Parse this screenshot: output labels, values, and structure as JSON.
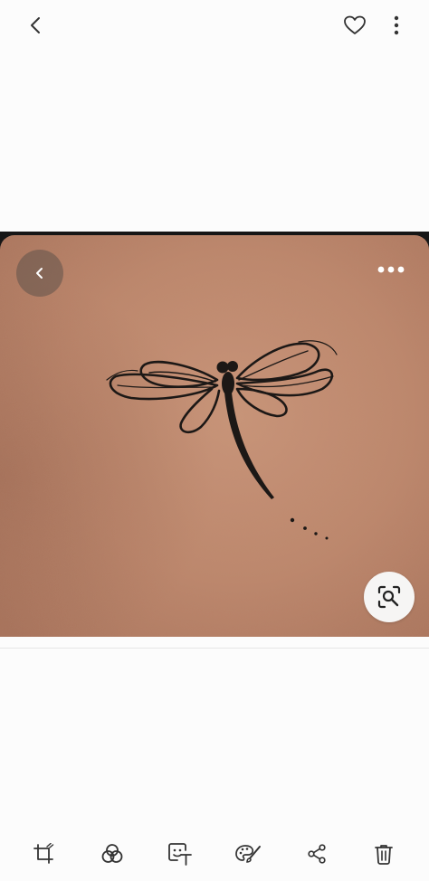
{
  "top_bar": {
    "icons": [
      "back-chevron-icon",
      "favorite-heart-icon",
      "more-vertical-icon"
    ]
  },
  "photo": {
    "subject": "dragonfly-tattoo",
    "overlay_icons": [
      "back-chevron-icon",
      "more-horizontal-icon",
      "visual-search-lens-icon"
    ]
  },
  "bottom_toolbar": {
    "tools": [
      {
        "name": "crop-icon"
      },
      {
        "name": "filters-icon"
      },
      {
        "name": "text-sticker-icon"
      },
      {
        "name": "palette-brush-icon"
      },
      {
        "name": "share-icon"
      },
      {
        "name": "trash-icon"
      }
    ]
  },
  "colors": {
    "background": "#fcfcfc",
    "icon": "#333333",
    "skin": "#c08a70",
    "ink": "#1c1816"
  }
}
